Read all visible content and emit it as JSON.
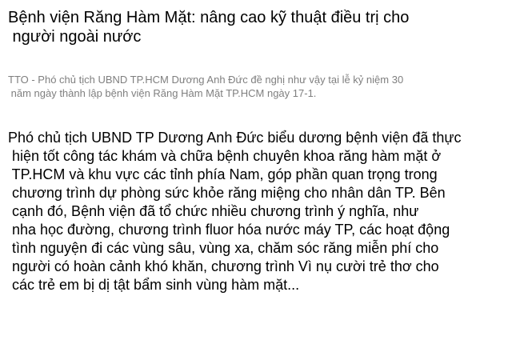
{
  "article": {
    "headline_lines": [
      "Bệnh viện Răng Hàm Mặt: nâng cao kỹ thuật điều trị cho",
      " người ngoài nước"
    ],
    "sapo_lines": [
      "TTO - Phó chủ tịch UBND TP.HCM Dương Anh Đức đề nghị như vậy tại lễ kỷ niệm 30",
      " năm ngày thành lập bệnh viện Răng Hàm Mặt TP.HCM ngày 17-1."
    ],
    "body_lines": [
      "Phó chủ tịch UBND TP Dương Anh Đức biểu dương bệnh viện đã thực",
      " hiện tốt công tác khám và chữa bệnh chuyên khoa răng hàm mặt ở",
      " TP.HCM và khu vực các tỉnh phía Nam, góp phần quan trọng trong",
      " chương trình dự phòng sức khỏe răng miệng cho nhân dân TP. Bên",
      " cạnh đó, Bệnh viện đã tổ chức nhiều chương trình ý nghĩa, như",
      " nha học đường, chương trình fluor hóa nước máy TP, các hoạt động",
      " tình nguyện đi các vùng sâu, vùng xa, chăm sóc răng miễn phí cho",
      " người có hoàn cảnh khó khăn, chương trình Vì nụ cười trẻ thơ cho",
      " các trẻ em bị dị tật bẩm sinh vùng hàm mặt..."
    ]
  },
  "colors": {
    "text": "#000000",
    "sapo": "#7f7f7f",
    "background": "#ffffff"
  }
}
